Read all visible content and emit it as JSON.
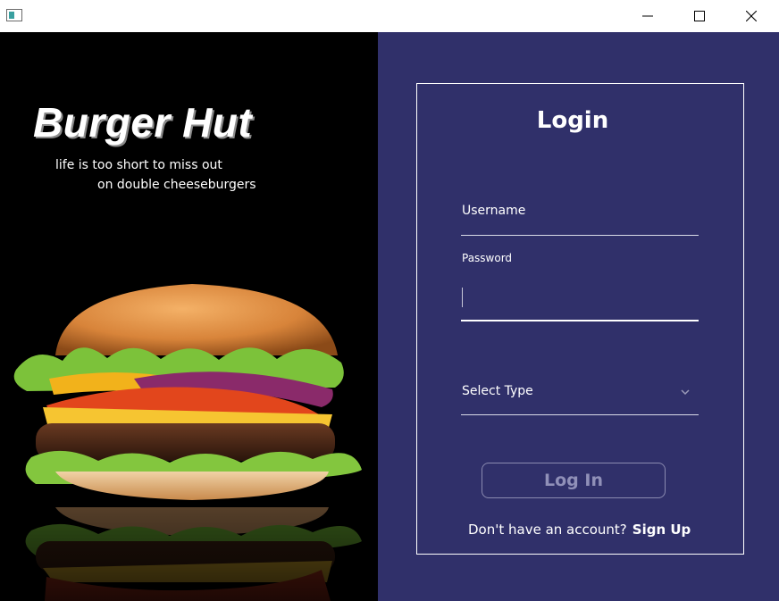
{
  "window": {
    "icon": "app-window-icon",
    "controls": {
      "minimize": "minimize-icon",
      "maximize": "maximize-icon",
      "close": "close-icon"
    }
  },
  "hero": {
    "title": "Burger Hut",
    "tagline_line1": "life is too short to miss out",
    "tagline_line2": "on double cheeseburgers",
    "image": "double-cheeseburger-photo"
  },
  "login": {
    "title": "Login",
    "username_label": "Username",
    "username_value": "",
    "password_label": "Password",
    "password_value": "",
    "select_label": "Select Type",
    "select_icon": "chevron-down-icon",
    "login_button": "Log In",
    "signup_prompt": "Don't have an account?",
    "signup_link": "Sign Up"
  },
  "colors": {
    "panel_background": "#30306a",
    "hero_background": "#000000",
    "text": "#ffffff",
    "button_disabled_text": "#9090b8"
  }
}
